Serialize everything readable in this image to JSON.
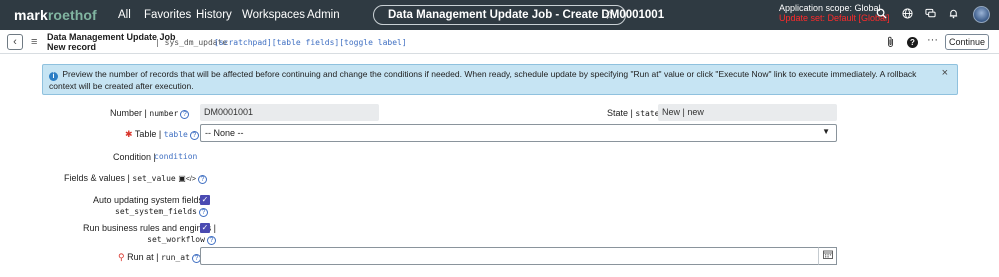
{
  "topbar": {
    "brand_a": "mark",
    "brand_b": "roethof",
    "nav": [
      "All",
      "Favorites",
      "History",
      "Workspaces",
      "Admin"
    ],
    "record_title": "Data Management Update Job - Create DM0001001",
    "star": "☆",
    "scope_line": "Application scope: Global",
    "update_set_line": "Update set: Default [Global]",
    "icons": [
      "search-icon",
      "globe-icon",
      "chat-icon",
      "bell-icon",
      "avatar"
    ]
  },
  "formheader": {
    "title_line1": "Data Management Update Job",
    "title_line2": "New record",
    "table_name": "| sys_dm_update",
    "links": "[scratchpad][table fields][toggle label]",
    "continue_label": "Continue"
  },
  "info": {
    "message": "Preview the number of records that will be affected before continuing and change the conditions if needed. When ready, schedule update by specifying \"Run at\" value or click \"Execute Now\" link to execute immediately. A rollback context will be created after execution."
  },
  "fields": {
    "number": {
      "label": "Number |",
      "name": "number",
      "value": "DM0001001"
    },
    "state": {
      "label": "State |",
      "name": "state",
      "value": "New | new"
    },
    "table": {
      "label": "Table |",
      "name": "table",
      "value": "-- None --"
    },
    "condition": {
      "label": "Condition |",
      "name": "condition"
    },
    "fields_values": {
      "label": "Fields & values |",
      "name": "set_value"
    },
    "auto_update": {
      "label": "Auto updating system fields |",
      "name": "set_system_fields",
      "checked": true
    },
    "run_rules": {
      "label": "Run business rules and engines |",
      "name": "set_workflow",
      "checked": true
    },
    "run_at": {
      "label": "Run at |",
      "name": "run_at",
      "value": ""
    }
  },
  "colors": {
    "topbar_bg": "#2f3a42",
    "brand_accent": "#81b5a1",
    "update_set_red": "#ff2a2a",
    "info_bg": "#c6e4f3",
    "checkbox": "#4a4ab2",
    "link_blue": "#3f6fc2"
  }
}
